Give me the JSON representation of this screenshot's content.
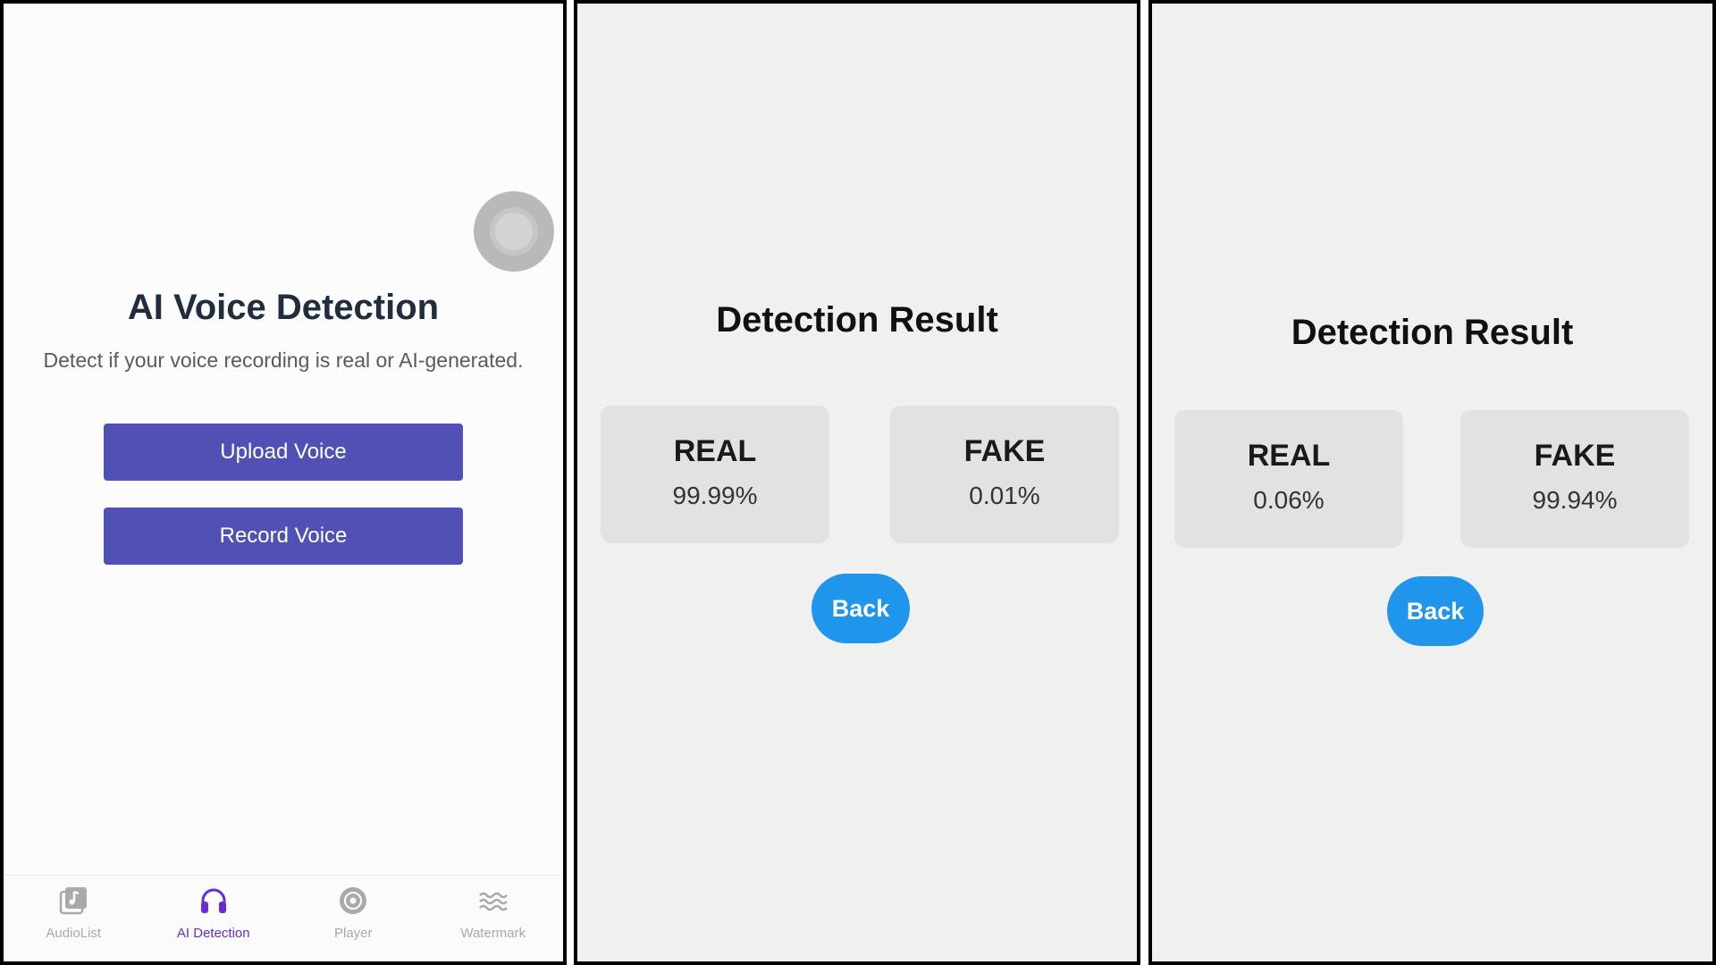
{
  "upload_screen": {
    "title": "AI Voice Detection",
    "subtitle": "Detect if your voice recording is real or AI-generated.",
    "upload_label": "Upload Voice",
    "record_label": "Record Voice",
    "tabs": [
      {
        "label": "AudioList",
        "icon": "music-note-icon",
        "active": false
      },
      {
        "label": "AI Detection",
        "icon": "headphones-icon",
        "active": true
      },
      {
        "label": "Player",
        "icon": "disc-icon",
        "active": false
      },
      {
        "label": "Watermark",
        "icon": "waves-icon",
        "active": false
      }
    ]
  },
  "results": [
    {
      "title": "Detection Result",
      "real_label": "REAL",
      "real_value": "99.99%",
      "fake_label": "FAKE",
      "fake_value": "0.01%",
      "back_label": "Back"
    },
    {
      "title": "Detection Result",
      "real_label": "REAL",
      "real_value": "0.06%",
      "fake_label": "FAKE",
      "fake_value": "99.94%",
      "back_label": "Back"
    }
  ],
  "colors": {
    "primary_button": "#5150b4",
    "back_button": "#1f95ec",
    "active_tab": "#6a2ad6",
    "inactive_tab": "#a9a9ad"
  }
}
